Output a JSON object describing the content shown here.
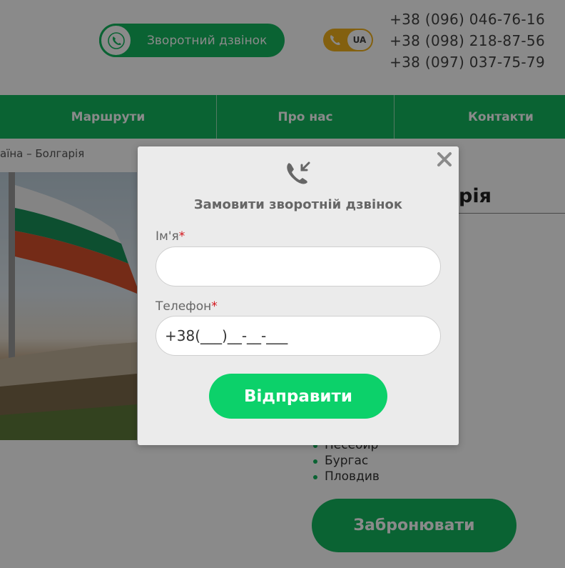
{
  "header": {
    "callback_label": "Зворотний дзвінок",
    "language": "UA",
    "phones": [
      "+38 (096) 046-76-16",
      "+38 (098) 218-87-56",
      "+38 (097) 037-75-79"
    ]
  },
  "nav": {
    "items": [
      "Маршрути",
      "Про нас",
      "Контакти"
    ]
  },
  "breadcrumb": "аїна – Болгарія",
  "page": {
    "title_partial": "рія",
    "cities": [
      "Несебир",
      "Бургас",
      "Пловдив"
    ],
    "book_label": "Забронювати"
  },
  "modal": {
    "title": "Замовити зворотній дзвінок",
    "name_label": "Ім'я",
    "phone_label": "Телефон",
    "required_mark": "*",
    "phone_mask": "+38(___)__-__-___",
    "submit_label": "Відправити"
  },
  "colors": {
    "brand_green": "#13b75e",
    "submit_green": "#0cd16a",
    "accent_yellow": "#f2b21d",
    "required_red": "#d3141b"
  },
  "icons": [
    "phone-callback-icon",
    "phone-incoming-icon",
    "close-icon",
    "phone-icon"
  ]
}
